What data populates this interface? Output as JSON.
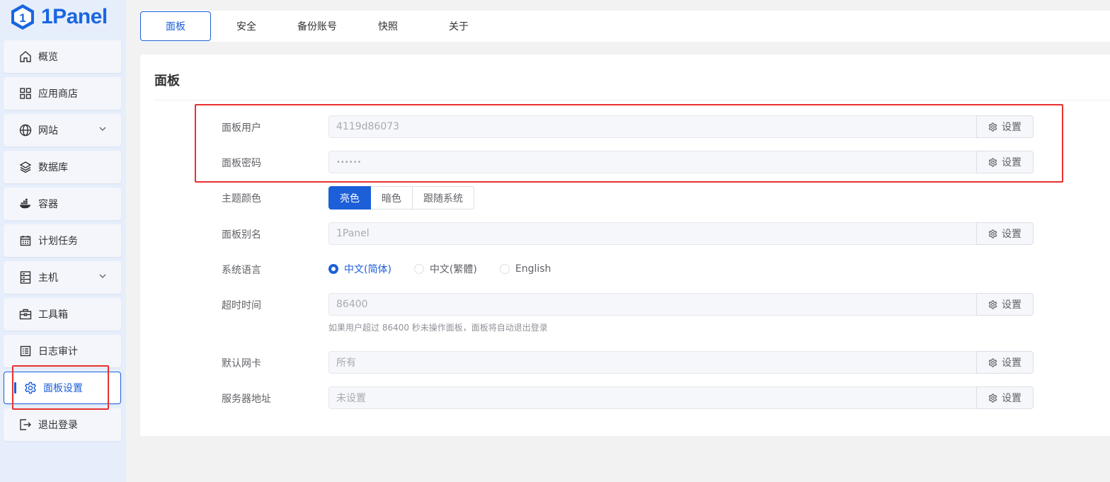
{
  "brand": {
    "name": "1Panel",
    "color": "#1a66e0"
  },
  "sidebar": {
    "items": [
      {
        "label": "概览",
        "icon": "home-icon"
      },
      {
        "label": "应用商店",
        "icon": "grid-icon"
      },
      {
        "label": "网站",
        "icon": "globe-icon",
        "has_submenu": true
      },
      {
        "label": "数据库",
        "icon": "layers-icon"
      },
      {
        "label": "容器",
        "icon": "docker-icon"
      },
      {
        "label": "计划任务",
        "icon": "calendar-icon"
      },
      {
        "label": "主机",
        "icon": "server-icon",
        "has_submenu": true
      },
      {
        "label": "工具箱",
        "icon": "toolbox-icon"
      },
      {
        "label": "日志审计",
        "icon": "log-icon"
      },
      {
        "label": "面板设置",
        "icon": "gear-icon",
        "active": true
      },
      {
        "label": "退出登录",
        "icon": "logout-icon"
      }
    ]
  },
  "tabs": [
    {
      "label": "面板",
      "active": true
    },
    {
      "label": "安全"
    },
    {
      "label": "备份账号"
    },
    {
      "label": "快照"
    },
    {
      "label": "关于"
    }
  ],
  "panel": {
    "title": "面板",
    "set_label": "设置",
    "user": {
      "label": "面板用户",
      "value": "4119d86073"
    },
    "password": {
      "label": "面板密码",
      "value": "••••••"
    },
    "theme": {
      "label": "主题颜色",
      "options": [
        "亮色",
        "暗色",
        "跟随系统"
      ],
      "selected": "亮色"
    },
    "alias": {
      "label": "面板别名",
      "value": "1Panel"
    },
    "language": {
      "label": "系统语言",
      "options": [
        "中文(简体)",
        "中文(繁體)",
        "English"
      ],
      "selected": "中文(简体)"
    },
    "timeout": {
      "label": "超时时间",
      "value": "86400",
      "help": "如果用户超过 86400 秒未操作面板，面板将自动退出登录"
    },
    "nic": {
      "label": "默认网卡",
      "value": "所有"
    },
    "server_address": {
      "label": "服务器地址",
      "value": "未设置"
    }
  },
  "colors": {
    "accent": "#1c5fd8",
    "highlight": "#e8302e"
  }
}
